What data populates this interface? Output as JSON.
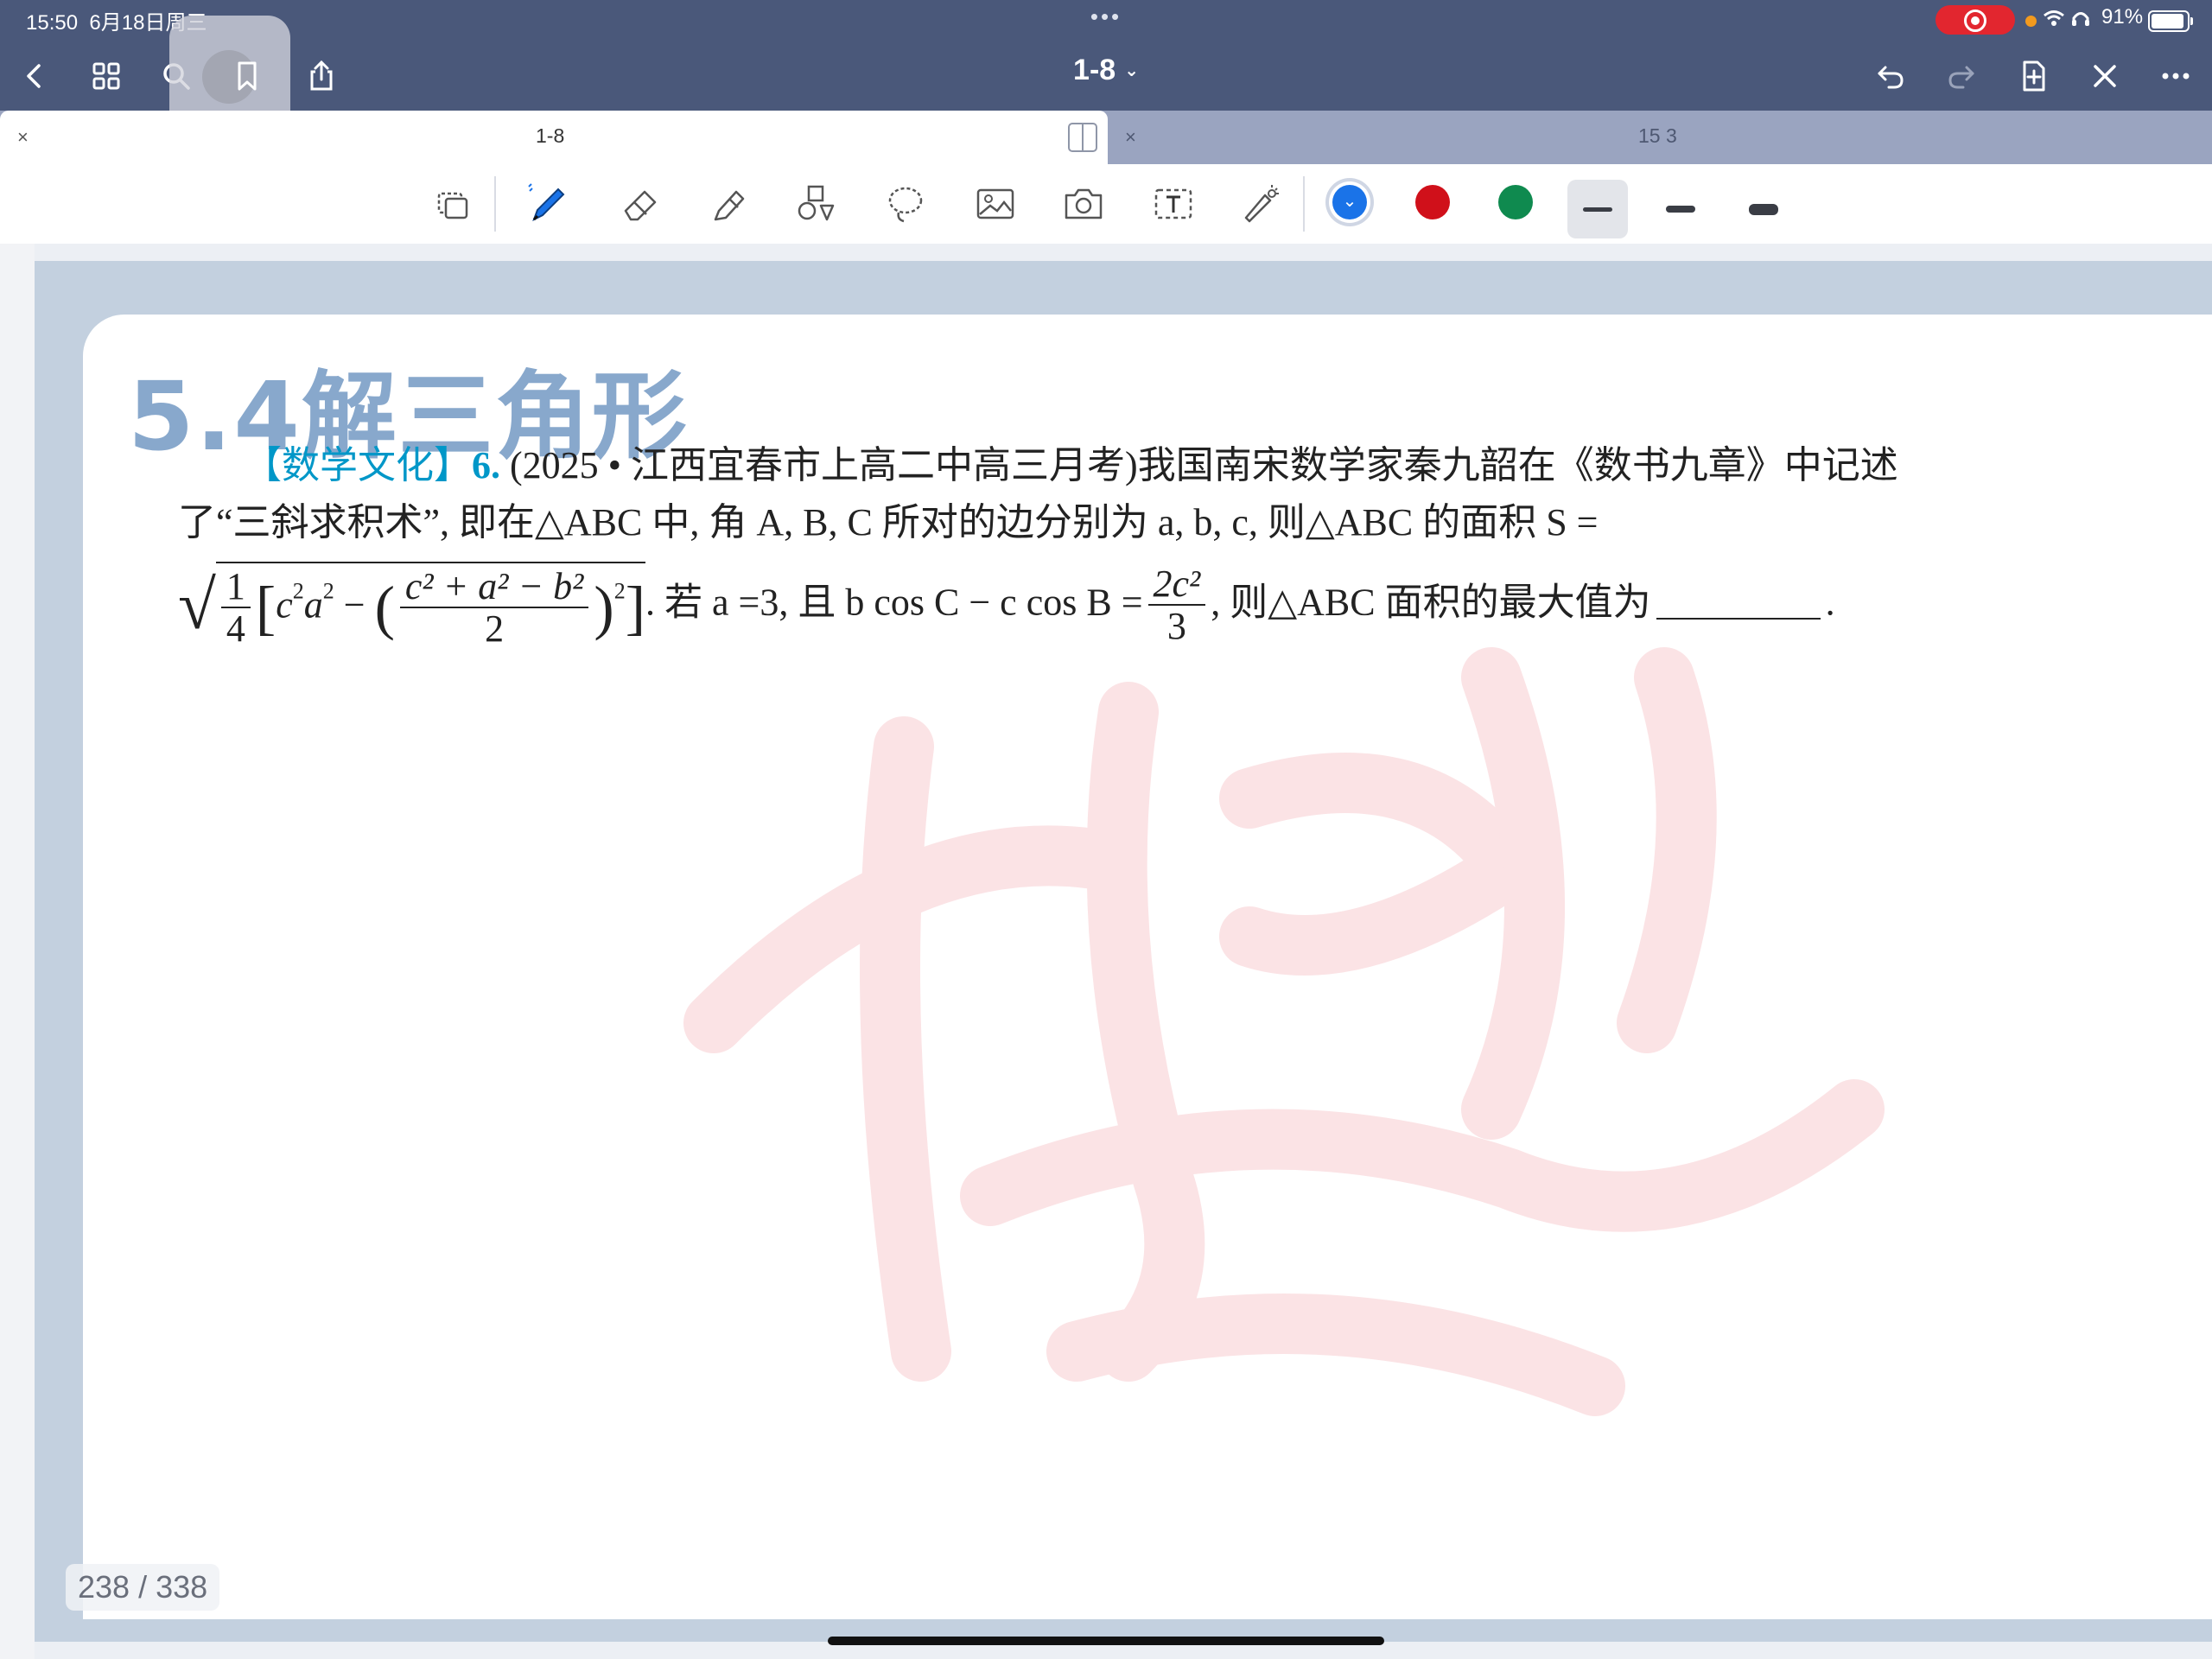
{
  "status_bar": {
    "time": "15:50",
    "date": "6月18日周三",
    "battery": "91%",
    "dots": "•••"
  },
  "nav": {
    "title": "1-8",
    "title_chevron": "⌄"
  },
  "tabs": [
    {
      "label": "1-8",
      "active": true,
      "close": "×"
    },
    {
      "label": "15 3",
      "active": false,
      "close": "×"
    }
  ],
  "toolbar": {
    "tools": [
      "select-icon",
      "pen-icon",
      "eraser-icon",
      "highlighter-icon",
      "shapes-icon",
      "lasso-icon",
      "image-icon",
      "camera-icon",
      "text-icon",
      "laser-pointer-icon"
    ],
    "colors": [
      "#1a73e8",
      "#d0101a",
      "#0f8a4f"
    ],
    "selected_color": "#1a73e8",
    "strokes": [
      "thin",
      "medium",
      "thick"
    ],
    "selected_stroke": "thin"
  },
  "document": {
    "heading": "5.4解三角形",
    "problem": {
      "tag": "【数学文化】",
      "number": "6.",
      "line1_rest": " (2025 • 江西宜春市上高二中高三月考)我国南宋数学家秦九韶在《数书九章》中记述",
      "line2": "了“三斜求积术”, 即在△ABC 中, 角 A, B, C 所对的边分别为 a, b, c, 则△ABC 的面积 S =",
      "line3_after_formula": ". 若 a =3, 且 b cos C − c cos B =",
      "frac_num": "2c²",
      "frac_den": "3",
      "line3_tail": ", 则△ABC 面积的最大值为",
      "line3_end": "."
    },
    "formula": {
      "quarter_num": "1",
      "quarter_den": "4",
      "inner_num": "c² + a² − b²",
      "inner_den": "2"
    }
  },
  "page_counter": "238 / 338"
}
